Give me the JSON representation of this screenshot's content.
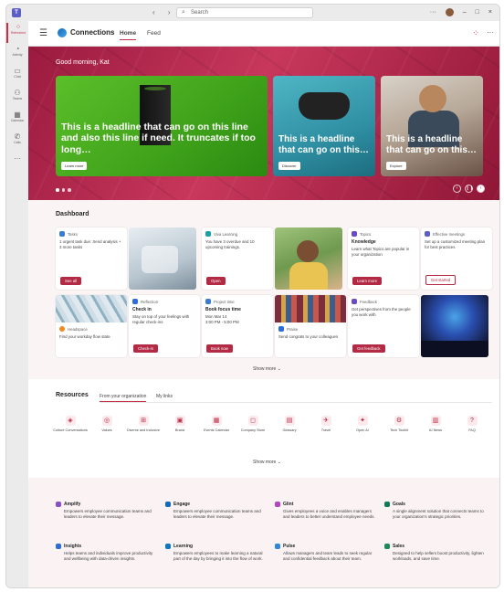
{
  "window": {
    "search_placeholder": "Search",
    "nav_back": "‹",
    "nav_forward": "›",
    "more": "···",
    "minimize": "–",
    "maximize": "□",
    "close": "×"
  },
  "rail": [
    {
      "label": "Refreshed",
      "icon": "apps-icon",
      "glyph": "⁘"
    },
    {
      "label": "Activity",
      "icon": "bell-icon",
      "glyph": "🔔︎"
    },
    {
      "label": "Chat",
      "icon": "chat-icon",
      "glyph": "💬︎"
    },
    {
      "label": "Teams",
      "icon": "teams-icon",
      "glyph": "👥︎"
    },
    {
      "label": "Calendar",
      "icon": "calendar-icon",
      "glyph": "▦"
    },
    {
      "label": "Calls",
      "icon": "phone-icon",
      "glyph": "✆"
    },
    {
      "label": "",
      "icon": "more-icon",
      "glyph": "···"
    }
  ],
  "app": {
    "name": "Connections",
    "tabs": [
      "Home",
      "Feed"
    ],
    "header_more": "···"
  },
  "hero": {
    "greeting": "Good morning, Kat",
    "cards": [
      {
        "headline": "This is a headline that can go on this line and also this line if need. It truncates if too long…",
        "button": "Learn more"
      },
      {
        "headline": "This is a headline that can go on this…",
        "button": "Discover"
      },
      {
        "headline": "This is a headline that can go on this…",
        "button": "Explore"
      }
    ],
    "controls": [
      "‹",
      "❙❙",
      "›"
    ]
  },
  "dashboard": {
    "title": "Dashboard",
    "cards": {
      "tasks": {
        "app": "Tasks",
        "text": "1 urgent task due: Send analysis + 3 more tasks",
        "button": "See all"
      },
      "viva": {
        "app": "Viva Learning",
        "text": "You have 3 overdue and 10 upcoming trainings.",
        "button": "Open"
      },
      "topics": {
        "app": "Topics",
        "title": "Knowledge",
        "text": "Learn what Topics are popular in your organization",
        "button": "Learn more"
      },
      "meetings": {
        "app": "Effective meetings",
        "text": "Set up a customized meeting plan for best practices",
        "button": "Get started"
      },
      "headspace": {
        "app": "Headspace",
        "text": "Find your workday flow state"
      },
      "reflection": {
        "app": "Reflection",
        "title": "Check in",
        "text": "Stay on top of your feelings with regular check-ins",
        "button": "Check-in"
      },
      "projecttime": {
        "app": "Project time",
        "title": "Book focus time",
        "line1": "Mon Mar 14",
        "line2": "3:00 PM - 5:00 PM",
        "button": "Book now"
      },
      "praise": {
        "app": "Praise",
        "text": "Send congrats to your colleagues"
      },
      "feedback": {
        "app": "Feedback",
        "text": "Get perspectives from the people you work with",
        "button": "Get feedback"
      }
    },
    "show_more": "Show more ⌄"
  },
  "resources": {
    "title": "Resources",
    "tabs": [
      "From your organization",
      "My links"
    ],
    "items": [
      "Culture Conversations",
      "Values",
      "Diverse and Inclusive",
      "Brand",
      "Events Calendar",
      "Company Store",
      "Glossary",
      "Travel",
      "Open AI",
      "Tech Toolkit",
      "AI News",
      "FAQ"
    ],
    "show_more": "Show more ⌄"
  },
  "footer": {
    "items": [
      {
        "name": "Amplify",
        "text": "Empowers employee communication teams and leaders to elevate their message.",
        "color": "#8a4fcf"
      },
      {
        "name": "Engage",
        "text": "Empowers employee communication teams and leaders to elevate their message.",
        "color": "#0f6cbd"
      },
      {
        "name": "Glint",
        "text": "Gives employees a voice and enables managers and leaders to better understand employee needs.",
        "color": "#b146c2"
      },
      {
        "name": "Goals",
        "text": "A single alignment solution that connects teams to your organization's strategic priorities.",
        "color": "#0e7a5a"
      },
      {
        "name": "Insights",
        "text": "Helps teams and individuals improve productivity and wellbeing with data-driven insights.",
        "color": "#2d6cdf"
      },
      {
        "name": "Learning",
        "text": "Empowers employees to make learning a natural part of the day by bringing it into the flow of work.",
        "color": "#0b76c5"
      },
      {
        "name": "Pulse",
        "text": "Allows managers and team leads to seek regular and confidential feedback about their team.",
        "color": "#2e86de"
      },
      {
        "name": "Sales",
        "text": "Designed to help sellers boost productivity, lighten workloads, and save time.",
        "color": "#1b8a5a"
      }
    ]
  },
  "colors": {
    "brand": "#c4314b",
    "button": "#b22a43",
    "hero": "#b82a50"
  }
}
